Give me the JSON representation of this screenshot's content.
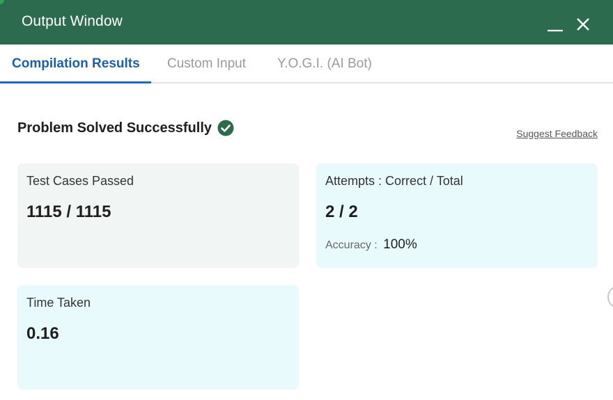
{
  "window": {
    "title": "Output Window",
    "minimize_icon": "minimize-icon",
    "close_icon": "close-icon",
    "header_color": "#2c6b4d"
  },
  "tabs": [
    {
      "label": "Compilation Results",
      "active": true
    },
    {
      "label": "Custom Input",
      "active": false
    },
    {
      "label": "Y.O.G.I. (AI Bot)",
      "active": false
    }
  ],
  "result": {
    "status": "Problem Solved Successfully",
    "status_icon": "check-circle-icon",
    "status_color": "#2c6b4d",
    "feedback_link": "Suggest Feedback"
  },
  "cards": {
    "test_cases": {
      "label": "Test Cases Passed",
      "value": "1115 / 1115"
    },
    "attempts": {
      "label": "Attempts : Correct / Total",
      "value": "2 / 2",
      "accuracy_label": "Accuracy :",
      "accuracy_value": "100%"
    },
    "time": {
      "label": "Time Taken",
      "value": "0.16"
    }
  },
  "colors": {
    "accent_tab": "#1f5fa8",
    "card_gray": "#f1f5f3",
    "card_cyan": "#e9fafd"
  }
}
